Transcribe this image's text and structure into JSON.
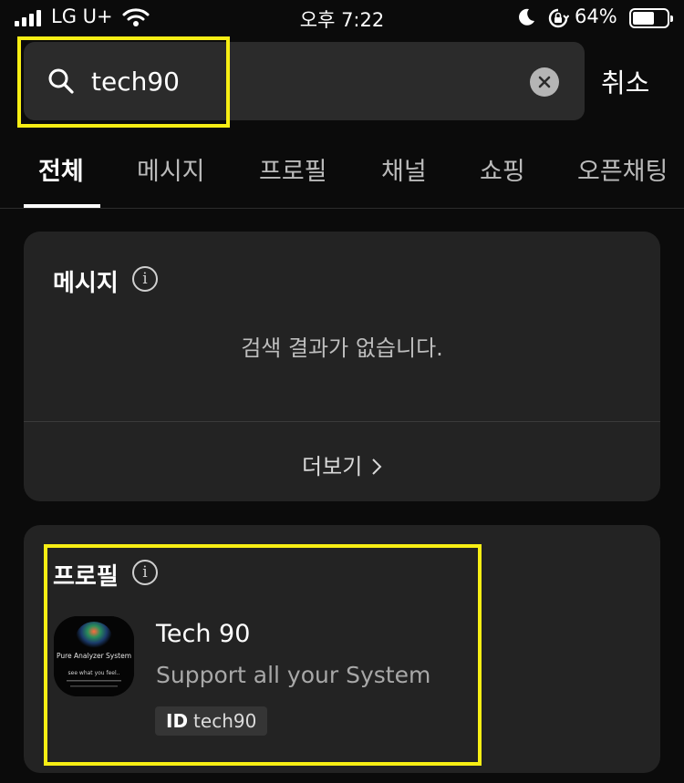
{
  "status_bar": {
    "carrier": "LG U+",
    "time": "오후 7:22",
    "battery_percent": "64%",
    "battery_level": 0.64
  },
  "search": {
    "query": "tech90",
    "cancel_label": "취소"
  },
  "tabs": [
    {
      "label": "전체",
      "active": true
    },
    {
      "label": "메시지",
      "active": false
    },
    {
      "label": "프로필",
      "active": false
    },
    {
      "label": "채널",
      "active": false
    },
    {
      "label": "쇼핑",
      "active": false
    },
    {
      "label": "오픈채팅",
      "active": false
    }
  ],
  "messages_section": {
    "title": "메시지",
    "empty_text": "검색 결과가 없습니다.",
    "more_label": "더보기"
  },
  "profile_section": {
    "title": "프로필",
    "result": {
      "name": "Tech 90",
      "description": "Support all your System",
      "id_label": "ID",
      "id_value": "tech90",
      "avatar_text": "Pure Analyzer System",
      "avatar_tagline": "see what you feel.."
    }
  },
  "colors": {
    "background": "#0b0b0b",
    "card": "#232323",
    "search_field": "#2b2b2b",
    "highlight": "#f7ee14"
  }
}
